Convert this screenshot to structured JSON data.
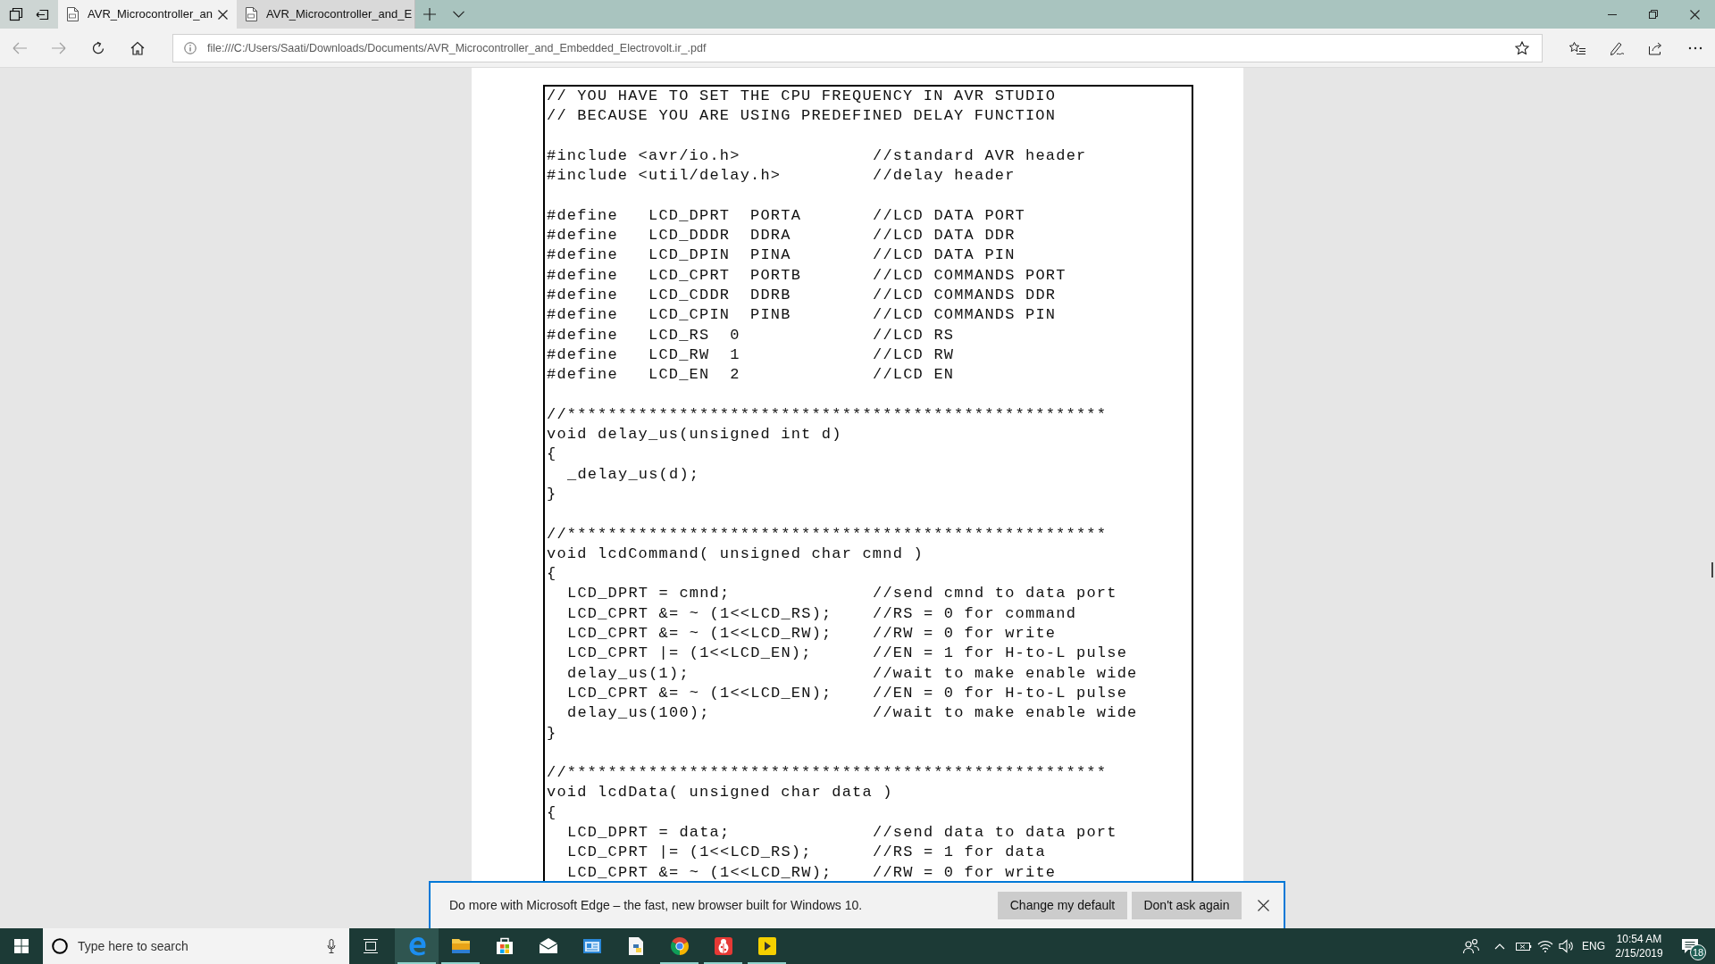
{
  "tabs": [
    {
      "title": "AVR_Microcontroller_an",
      "selected": true
    },
    {
      "title": "AVR_Microcontroller_and_E",
      "selected": false
    }
  ],
  "navigation": {
    "back": {
      "disabled": true
    },
    "forward": {
      "disabled": true
    }
  },
  "address_bar": {
    "url": "file:///C:/Users/Saati/Downloads/Documents/AVR_Microcontroller_and_Embedded_Electrovolt.ir_.pdf"
  },
  "document": {
    "blocks": [
      [
        {
          "code": "// YOU HAVE TO SET THE CPU FREQUENCY IN AVR STUDIO"
        },
        {
          "code": "// BECAUSE YOU ARE USING PREDEFINED DELAY FUNCTION"
        }
      ],
      [
        {
          "code": "#include <avr/io.h>",
          "comment": "//standard AVR header"
        },
        {
          "code": "#include <util/delay.h>",
          "comment": "//delay header"
        }
      ],
      [
        {
          "code": "#define   LCD_DPRT  PORTA",
          "comment": "//LCD DATA PORT"
        },
        {
          "code": "#define   LCD_DDDR  DDRA",
          "comment": "//LCD DATA DDR"
        },
        {
          "code": "#define   LCD_DPIN  PINA",
          "comment": "//LCD DATA PIN"
        },
        {
          "code": "#define   LCD_CPRT  PORTB",
          "comment": "//LCD COMMANDS PORT"
        },
        {
          "code": "#define   LCD_CDDR  DDRB",
          "comment": "//LCD COMMANDS DDR"
        },
        {
          "code": "#define   LCD_CPIN  PINB",
          "comment": "//LCD COMMANDS PIN"
        },
        {
          "code": "#define   LCD_RS  0",
          "comment": "//LCD RS"
        },
        {
          "code": "#define   LCD_RW  1",
          "comment": "//LCD RW"
        },
        {
          "code": "#define   LCD_EN  2",
          "comment": "//LCD EN"
        }
      ],
      [
        {
          "code": "//*****************************************************"
        },
        {
          "code": "void delay_us(unsigned int d)"
        },
        {
          "code": "{",
          "children": [
            {
              "code": "_delay_us(d);"
            }
          ]
        },
        {
          "code": "}"
        }
      ],
      [
        {
          "code": "//*****************************************************"
        },
        {
          "code": "void lcdCommand( unsigned char cmnd )"
        },
        {
          "code": "{",
          "children": [
            {
              "code": "LCD_DPRT = cmnd;",
              "comment": "//send cmnd to data port"
            },
            {
              "code": "LCD_CPRT &= ~ (1<<LCD_RS);",
              "comment": "//RS = 0 for command"
            },
            {
              "code": "LCD_CPRT &= ~ (1<<LCD_RW);",
              "comment": "//RW = 0 for write"
            },
            {
              "code": "LCD_CPRT |= (1<<LCD_EN);",
              "comment": "//EN = 1 for H-to-L pulse"
            },
            {
              "code": "delay_us(1);",
              "comment": "//wait to make enable wide"
            },
            {
              "code": "LCD_CPRT &= ~ (1<<LCD_EN);",
              "comment": "//EN = 0 for H-to-L pulse"
            },
            {
              "code": "delay_us(100);",
              "comment": "//wait to make enable wide"
            }
          ]
        },
        {
          "code": "}"
        }
      ],
      [
        {
          "code": "//*****************************************************"
        },
        {
          "code": "void lcdData( unsigned char data )"
        },
        {
          "code": "{",
          "children": [
            {
              "code": "LCD_DPRT = data;",
              "comment": "//send data to data port"
            },
            {
              "code": "LCD_CPRT |= (1<<LCD_RS);",
              "comment": "//RS = 1 for data"
            },
            {
              "code": "LCD_CPRT &= ~ (1<<LCD_RW);",
              "comment": "//RW = 0 for write"
            }
          ]
        }
      ]
    ]
  },
  "notification": {
    "message": "Do more with Microsoft Edge – the fast, new browser built for Windows 10.",
    "buttons": [
      "Change my default",
      "Don't ask again"
    ]
  },
  "taskbar": {
    "search": {
      "placeholder": "Type here to search"
    },
    "apps": [
      {
        "kind": "edge",
        "active": true,
        "running": true
      },
      {
        "kind": "explorer",
        "active": false,
        "running": true
      },
      {
        "kind": "store",
        "active": false,
        "running": false
      },
      {
        "kind": "mail",
        "active": false,
        "running": false
      },
      {
        "kind": "viewer",
        "active": false,
        "running": false
      },
      {
        "kind": "python",
        "active": false,
        "running": false
      },
      {
        "kind": "chrome",
        "active": false,
        "running": true
      },
      {
        "kind": "ladybug",
        "active": false,
        "running": true
      },
      {
        "kind": "player",
        "active": false,
        "running": true
      }
    ],
    "tray": {
      "language": "ENG",
      "time": "10:54 AM",
      "date": "2/15/2019",
      "notification_count": "18"
    }
  }
}
